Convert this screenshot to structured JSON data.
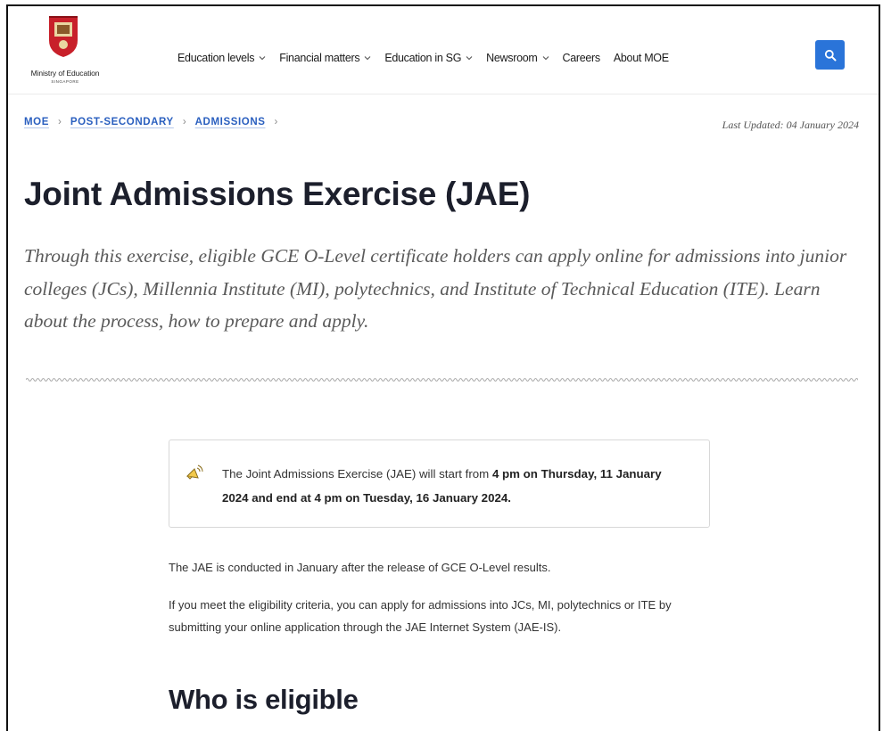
{
  "header": {
    "logo": {
      "name": "Ministry of Education",
      "sub": "SINGAPORE"
    },
    "nav": [
      {
        "label": "Education levels",
        "has_dropdown": true
      },
      {
        "label": "Financial matters",
        "has_dropdown": true
      },
      {
        "label": "Education in SG",
        "has_dropdown": true
      },
      {
        "label": "Newsroom",
        "has_dropdown": true
      },
      {
        "label": "Careers",
        "has_dropdown": false
      },
      {
        "label": "About MOE",
        "has_dropdown": false
      }
    ],
    "search_icon": "search-icon",
    "accent_color": "#2a74d9"
  },
  "breadcrumb": {
    "items": [
      "MOE",
      "POST-SECONDARY",
      "ADMISSIONS"
    ],
    "separator": "›"
  },
  "last_updated": "Last Updated: 04 January 2024",
  "page": {
    "title": "Joint Admissions Exercise (JAE)",
    "intro": "Through this exercise, eligible GCE O-Level certificate holders can apply online for admissions into junior colleges (JCs), Millennia Institute (MI), polytechnics, and Institute of Technical Education (ITE). Learn about the process, how to prepare and apply."
  },
  "notice": {
    "icon": "megaphone-icon",
    "text_before": "The Joint Admissions Exercise (JAE) will start from ",
    "text_bold": "4 pm on Thursday, 11 January 2024 and end at 4 pm on Tuesday, 16 January 2024."
  },
  "content": {
    "para1": "The JAE is conducted in January after the release of GCE O-Level results.",
    "para2": "If you meet the eligibility criteria, you can apply for admissions into JCs, MI, polytechnics or ITE by submitting your online application through the JAE Internet System (JAE-IS).",
    "heading_eligible": "Who is eligible"
  }
}
